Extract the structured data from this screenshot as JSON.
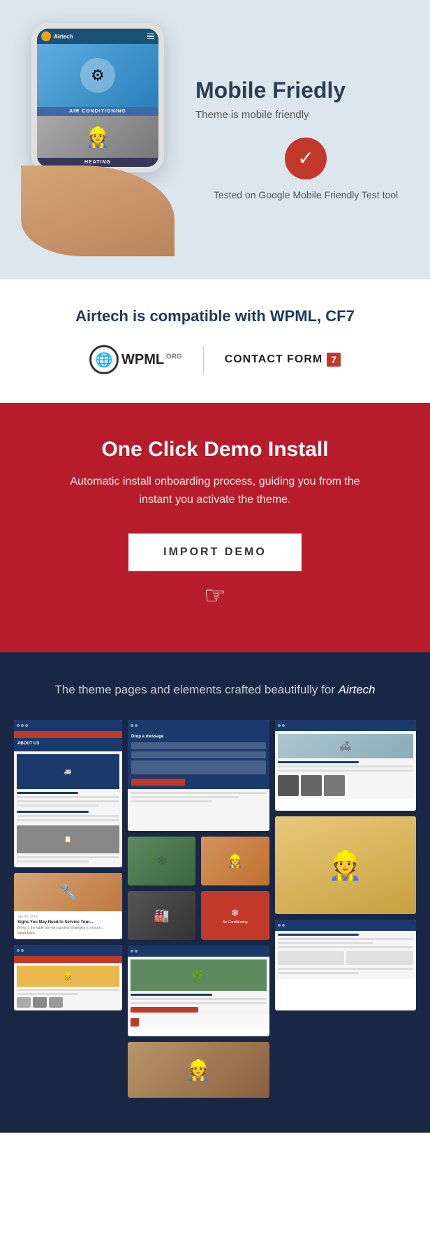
{
  "mobile_section": {
    "title": "Mobile Friedly",
    "subtitle": "Theme is mobile friendly",
    "check_label": "Tested on Google Mobile Friendly Test tool",
    "phone_label1": "AIR CONDITIONING",
    "phone_label2": "HEATING"
  },
  "compatible_section": {
    "title": "Airtech is compatible with WPML, CF7",
    "wpml_text": "WPML",
    "wpml_suffix": ".ORG",
    "cf7_text": "CONTACT FORM",
    "cf7_number": "7"
  },
  "demo_section": {
    "title": "One Click Demo Install",
    "subtitle": "Automatic install onboarding process, guiding you from the instant you activate the theme.",
    "button_label": "IMPORT DEMO"
  },
  "pages_section": {
    "intro_text": "The theme pages and elements crafted beautifully for ",
    "intro_brand": "Airtech"
  },
  "colors": {
    "red": "#b71c2a",
    "dark_blue": "#1a2744",
    "navy": "#1a3a6c",
    "white": "#ffffff"
  }
}
